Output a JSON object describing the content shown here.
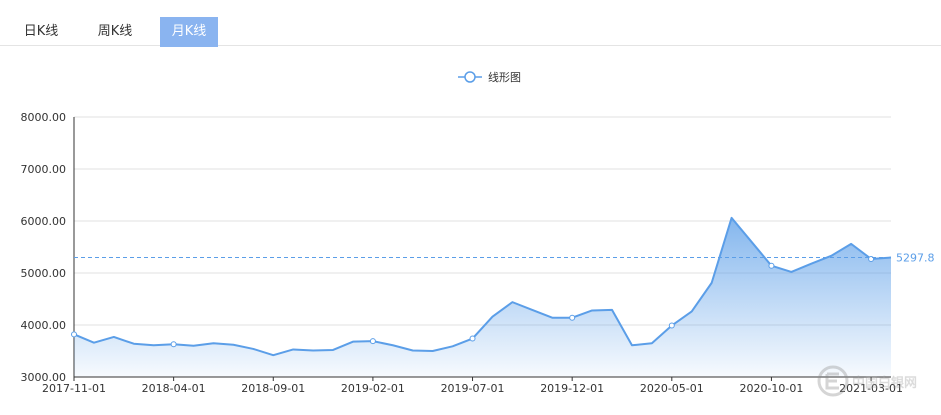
{
  "tabs": [
    {
      "label": "日K线",
      "active": false
    },
    {
      "label": "周K线",
      "active": false
    },
    {
      "label": "月K线",
      "active": true
    }
  ],
  "colors": {
    "line": "#5b9ee8",
    "active_tab": "#8ab4f0",
    "grid": "#e0e0e0"
  },
  "watermark": {
    "text": "中国白银网",
    "icon": "silver-network-logo-icon"
  },
  "chart_data": {
    "type": "area",
    "legend": {
      "label": "线形图",
      "position": "top-center"
    },
    "x_tick_labels": [
      "2017-11-01",
      "2018-04-01",
      "2018-09-01",
      "2019-02-01",
      "2019-07-01",
      "2019-12-01",
      "2020-05-01",
      "2020-10-01",
      "2021-03-01"
    ],
    "y_tick_labels": [
      "3000.00",
      "4000.00",
      "5000.00",
      "6000.00",
      "7000.00",
      "8000.00"
    ],
    "ylim": [
      3000,
      8000
    ],
    "grid": true,
    "x": [
      "2017-11-01",
      "2017-12-01",
      "2018-01-01",
      "2018-02-01",
      "2018-03-01",
      "2018-04-01",
      "2018-05-01",
      "2018-06-01",
      "2018-07-01",
      "2018-08-01",
      "2018-09-01",
      "2018-10-01",
      "2018-11-01",
      "2018-12-01",
      "2019-01-01",
      "2019-02-01",
      "2019-03-01",
      "2019-04-01",
      "2019-05-01",
      "2019-06-01",
      "2019-07-01",
      "2019-08-01",
      "2019-09-01",
      "2019-10-01",
      "2019-11-01",
      "2019-12-01",
      "2020-01-01",
      "2020-02-01",
      "2020-03-01",
      "2020-04-01",
      "2020-05-01",
      "2020-06-01",
      "2020-07-01",
      "2020-08-01",
      "2020-09-01",
      "2020-10-01",
      "2020-11-01",
      "2020-12-01",
      "2021-01-01",
      "2021-02-01",
      "2021-03-01",
      "2021-04-01"
    ],
    "series": [
      {
        "values": [
          3820,
          3660,
          3770,
          3640,
          3610,
          3630,
          3600,
          3650,
          3620,
          3540,
          3420,
          3530,
          3510,
          3520,
          3680,
          3690,
          3610,
          3510,
          3500,
          3590,
          3740,
          4160,
          4440,
          4290,
          4140,
          4140,
          4280,
          4290,
          3610,
          3650,
          3990,
          4260,
          4810,
          6060,
          5600,
          5140,
          5020,
          5180,
          5330,
          5560,
          5270,
          5297.8
        ],
        "marked_indices": [
          0,
          5,
          15,
          20,
          25,
          30,
          35,
          40
        ]
      }
    ],
    "mark_line": {
      "value": 5297.8,
      "label": "5297.8"
    }
  }
}
